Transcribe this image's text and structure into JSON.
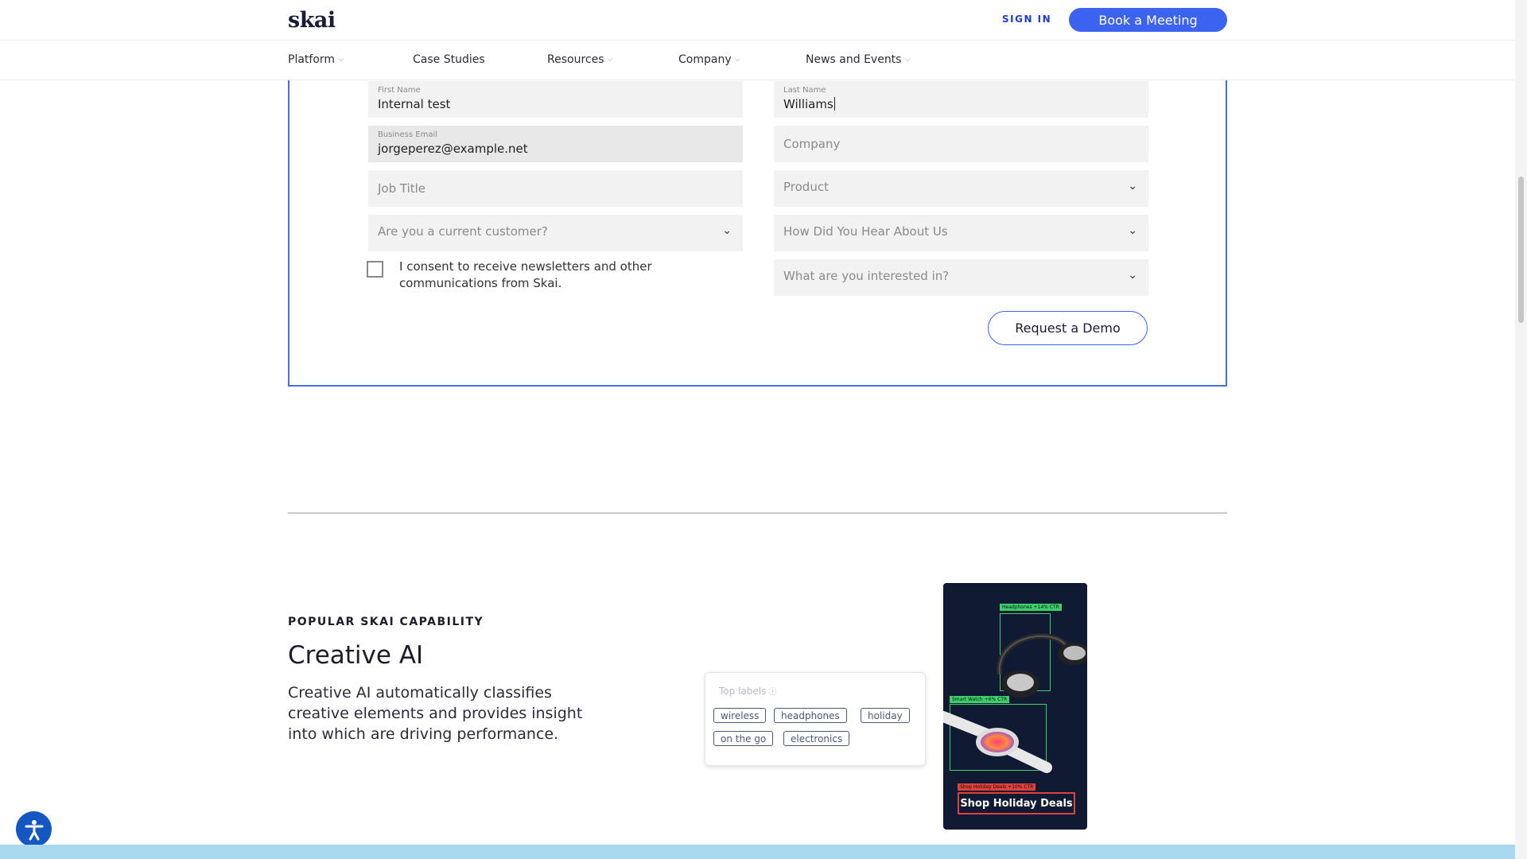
{
  "header": {
    "logo": "skai",
    "sign_in": "SIGN IN",
    "book_meeting": "Book a Meeting"
  },
  "nav": {
    "items": [
      {
        "label": "Platform",
        "has_dropdown": true
      },
      {
        "label": "Case Studies",
        "has_dropdown": false
      },
      {
        "label": "Resources",
        "has_dropdown": true
      },
      {
        "label": "Company",
        "has_dropdown": true
      },
      {
        "label": "News and Events",
        "has_dropdown": true
      }
    ]
  },
  "form": {
    "first_name": {
      "label": "First Name",
      "value": "Internal test"
    },
    "last_name": {
      "label": "Last Name",
      "value": "Williams"
    },
    "business_email": {
      "label": "Business Email",
      "value": "jorgeperez@example.net"
    },
    "company": {
      "placeholder": "Company"
    },
    "job_title": {
      "placeholder": "Job Title"
    },
    "product": {
      "placeholder": "Product"
    },
    "current_customer": {
      "placeholder": "Are you a current customer?"
    },
    "hear_about": {
      "placeholder": "How Did You Hear About Us"
    },
    "interested_in": {
      "placeholder": "What are you interested in?"
    },
    "consent_text": "I consent to receive newsletters and other communications from Skai.",
    "consent_checked": false,
    "submit_label": "Request a Demo"
  },
  "capability": {
    "eyebrow": "POPULAR SKAI CAPABILITY",
    "title": "Creative AI",
    "description": "Creative AI automatically classifies creative elements and provides insight into which are driving performance.",
    "labels_card": {
      "title": "Top labels",
      "tags": [
        "wireless",
        "headphones",
        "holiday",
        "on the go",
        "electronics"
      ]
    },
    "ad_preview": {
      "detections": [
        {
          "label": "Headphones +14% CTR",
          "color": "#3ecf6b"
        },
        {
          "label": "Smart Watch +6% CTR",
          "color": "#3ecf6b"
        },
        {
          "label": "Shop Holiday Deals +10% CTR",
          "color": "#e0413c"
        }
      ],
      "cta": "Shop Holiday Deals"
    }
  },
  "colors": {
    "accent": "#3b63f0",
    "form_border": "#4a6de0",
    "footer_band": "#a7d8ee"
  }
}
